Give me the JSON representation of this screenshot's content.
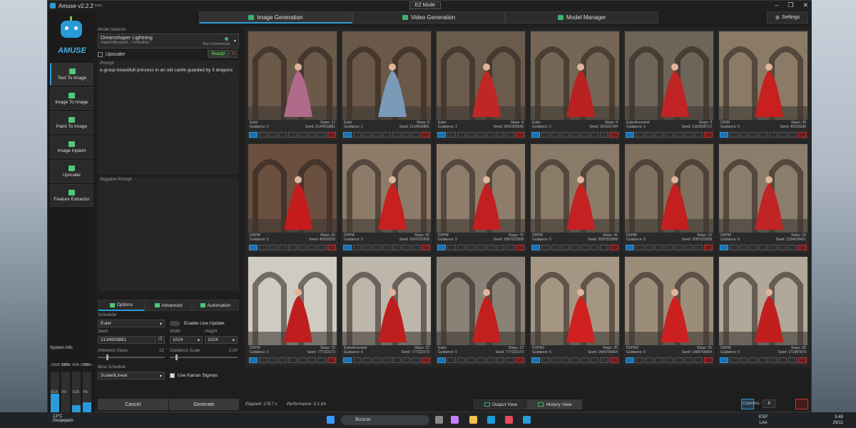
{
  "window": {
    "title": "Amuse v2.2.2",
    "beta": "beta",
    "mode_button": "EZ Mode"
  },
  "top_tabs": [
    {
      "label": "Image Generation"
    },
    {
      "label": "Video Generation"
    },
    {
      "label": "Model Manager"
    }
  ],
  "settings_label": "Settings",
  "sidebar": {
    "logo_text": "AMUSE",
    "items": [
      {
        "label": "Text To Image"
      },
      {
        "label": "Image To Image"
      },
      {
        "label": "Paint To Image"
      },
      {
        "label": "Image Inpaint"
      },
      {
        "label": "Upscaler"
      },
      {
        "label": "Feature Extractor"
      }
    ],
    "system_info": "System Info",
    "bars": [
      {
        "top": "16GB",
        "pct": "100%",
        "bottom": "8GB",
        "name": "RAM",
        "fill": 0.5
      },
      {
        "top": "",
        "pct": "100%",
        "bottom": "0%",
        "name": "CPU",
        "fill": 0.05
      },
      {
        "top": "4GB",
        "pct": "100%",
        "bottom": "1GB",
        "name": "VRAM",
        "fill": 0.25
      },
      {
        "top": "",
        "pct": "100%",
        "bottom": "0%",
        "name": "GPU",
        "fill": 0.3
      }
    ]
  },
  "left": {
    "model_label": "Model Selector",
    "model_name": "Dreamshaper Lightning",
    "model_sub": "StableDiffusionXL - ControlNet",
    "model_license": "Non-Commercial",
    "upscaler_label": "Upscaler",
    "ready": "Ready!",
    "close": "✕",
    "prompt_label": "Prompt",
    "prompt_text": "a group beautifull princess in an old castle guarded by 3 dragons",
    "neg_label": "Negative Prompt",
    "tabs": [
      {
        "label": "Options"
      },
      {
        "label": "Advanced"
      },
      {
        "label": "Automation"
      }
    ],
    "scheduler_label": "Scheduler",
    "scheduler_value": "Euler",
    "live_update": "Enable Live Update",
    "seed_label": "Seed",
    "seed_value": "2134933881",
    "width_label": "Width",
    "width_value": "1024",
    "height_label": "Height",
    "height_value": "1024",
    "steps_label": "Inference Steps",
    "steps_value": "12",
    "guidance_label": "Guidance Scale",
    "guidance_value": "2.00",
    "beta_label": "Beta Schedule",
    "beta_value": "ScaledLinear",
    "karras": "Use Karras Sigmas",
    "cancel": "Cancel",
    "generate": "Generate"
  },
  "cards": [
    {
      "sched": "Euler",
      "steps": "12",
      "guid": "2",
      "seed": "2134933881",
      "bg": "#6b5a4a",
      "fig": "#b06a8a"
    },
    {
      "sched": "Euler",
      "steps": "8",
      "guid": "2",
      "seed": "2134933881",
      "bg": "#6a5848",
      "fig": "#7a9ab8"
    },
    {
      "sched": "Euler",
      "steps": "8",
      "guid": "2",
      "seed": "2041355546",
      "bg": "#6b5b4c",
      "fig": "#c02626"
    },
    {
      "sched": "Euler",
      "steps": "8",
      "guid": "2",
      "seed": "301931784",
      "bg": "#756656",
      "fig": "#b82222"
    },
    {
      "sched": "EulerAncestral",
      "steps": "8",
      "guid": "2",
      "seed": "1326838712",
      "bg": "#6d6557",
      "fig": "#c02424"
    },
    {
      "sched": "DDIM",
      "steps": "35",
      "guid": "5",
      "seed": "45933230",
      "bg": "#8a7a66",
      "fig": "#c81f1f"
    },
    {
      "sched": "DDPM",
      "steps": "35",
      "guid": "5",
      "seed": "45933230",
      "bg": "#6b5040",
      "fig": "#c41c1c"
    },
    {
      "sched": "DDPM",
      "steps": "95",
      "guid": "5",
      "seed": "2097022508",
      "bg": "#8c7b68",
      "fig": "#c62020"
    },
    {
      "sched": "DDPM",
      "steps": "75",
      "guid": "5",
      "seed": "2097022508",
      "bg": "#8e7d6b",
      "fig": "#c22020"
    },
    {
      "sched": "DDPM",
      "steps": "41",
      "guid": "5",
      "seed": "2097022508",
      "bg": "#8a7a68",
      "fig": "#c42222"
    },
    {
      "sched": "DDPM",
      "steps": "23",
      "guid": "5",
      "seed": "2097022508",
      "bg": "#7e6f5e",
      "fig": "#c41e1e"
    },
    {
      "sched": "DDPM",
      "steps": "23",
      "guid": "5",
      "seed": "1234028451",
      "bg": "#8b7d6c",
      "fig": "#c02424"
    },
    {
      "sched": "DDPM",
      "steps": "23",
      "guid": "5",
      "seed": "777323173",
      "bg": "#cfcac2",
      "fig": "#c01e1e"
    },
    {
      "sched": "EulerAncestral",
      "steps": "23",
      "guid": "5",
      "seed": "777323173",
      "bg": "#bdb6aa",
      "fig": "#be1e1e"
    },
    {
      "sched": "Euler",
      "steps": "23",
      "guid": "5",
      "seed": "777323173",
      "bg": "#8a8276",
      "fig": "#c21f1f"
    },
    {
      "sched": "KDPM2",
      "steps": "30",
      "guid": "5",
      "seed": "1464766064",
      "bg": "#a59683",
      "fig": "#d02020"
    },
    {
      "sched": "KDPM2",
      "steps": "30",
      "guid": "5",
      "seed": "1464766064",
      "bg": "#9c8d7a",
      "fig": "#cc2020"
    },
    {
      "sched": "DDPM",
      "steps": "30",
      "guid": "5",
      "seed": "171987879",
      "bg": "#b1a899",
      "fig": "#c21e1e"
    }
  ],
  "status": {
    "elapsed": "Elapsed: 178.7 s",
    "performance": "Performance: 0.1 it/s",
    "output_view": "Output View",
    "history_view": "History View",
    "columns_label": "Columns:",
    "columns_value": "6"
  },
  "taskbar": {
    "temp": "13°C",
    "weather": "Despejado",
    "search": "Buscar",
    "lang1": "ESP",
    "lang2": "LAA",
    "time": "5:48",
    "date": "29/11"
  }
}
